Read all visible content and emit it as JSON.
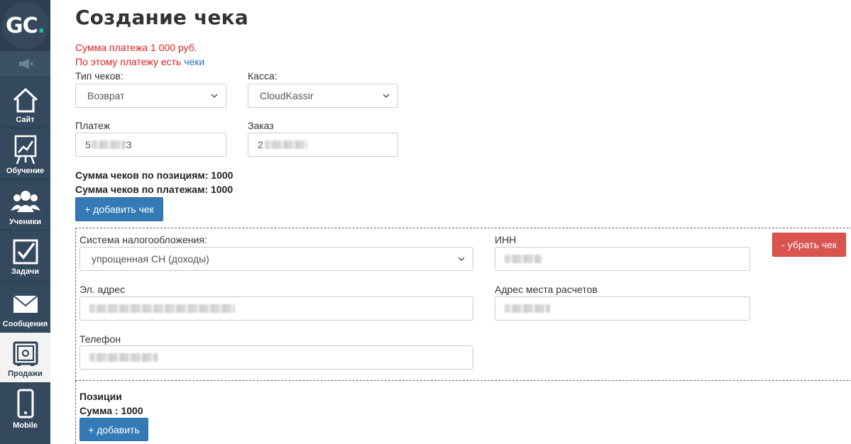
{
  "sidebar": {
    "logo": {
      "text": "GC",
      "dot": "."
    },
    "speaker_icon": "megaphone-icon",
    "items": [
      {
        "label": "Сайт",
        "icon": "home-icon"
      },
      {
        "label": "Обучение",
        "icon": "chart-board-icon"
      },
      {
        "label": "Ученики",
        "icon": "users-icon"
      },
      {
        "label": "Задачи",
        "icon": "checkbox-icon"
      },
      {
        "label": "Сообщения",
        "icon": "envelope-icon"
      },
      {
        "label": "Продажи",
        "icon": "safe-icon",
        "active": true
      },
      {
        "label": "Mobile",
        "icon": "phone-icon"
      }
    ],
    "colors": {
      "bg": "#34495e",
      "accent": "#1abc9c"
    }
  },
  "page": {
    "title": "Создание чека",
    "alert": {
      "line1": "Сумма платежа 1 000 руб.",
      "line2_prefix": "По этому платежу есть ",
      "line2_link": "чеки"
    },
    "receipt_type": {
      "label": "Тип чеков:",
      "value": "Возврат"
    },
    "cashbox": {
      "label": "Касса:",
      "value": "CloudKassir"
    },
    "payment": {
      "label": "Платеж",
      "value_start": "5",
      "value_end": "3"
    },
    "order": {
      "label": "Заказ",
      "value_start": "2"
    },
    "sum_positions": "Сумма чеков по позициям: 1000",
    "sum_payments": "Сумма чеков по платежам: 1000",
    "add_receipt_button": "+ добавить чек"
  },
  "receipt": {
    "tax_system": {
      "label": "Система налогообложения:",
      "value": "упрощенная СН (доходы)"
    },
    "inn": {
      "label": "ИНН"
    },
    "email": {
      "label": "Эл. адрес"
    },
    "address": {
      "label": "Адрес места расчетов"
    },
    "phone": {
      "label": "Телефон"
    },
    "remove_button": "- убрать чек"
  },
  "positions": {
    "title": "Позиции",
    "sum": "Сумма : 1000",
    "add_button": "+ добавить"
  },
  "colors": {
    "primary_button": "#337ab7",
    "danger_button": "#d9534f",
    "alert_text": "#e02020",
    "link": "#2a6fb5"
  }
}
